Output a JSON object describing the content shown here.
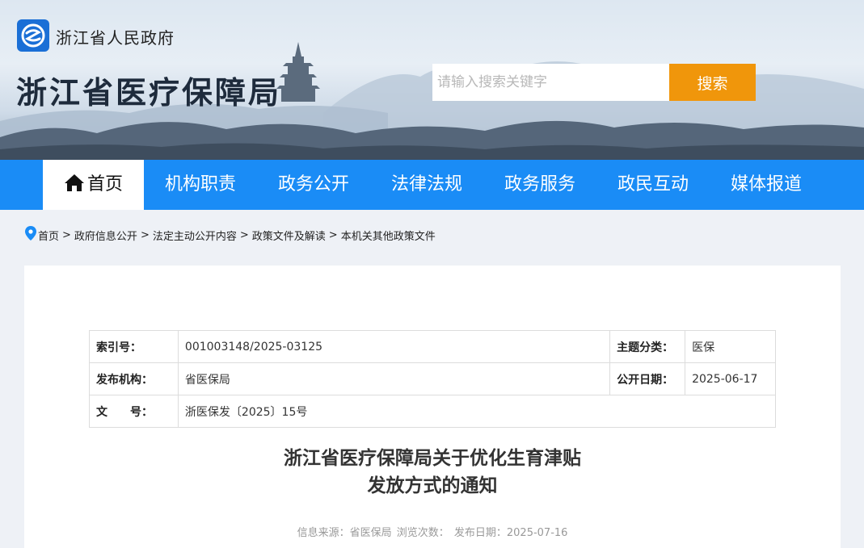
{
  "header": {
    "gov_name": "浙江省人民政府",
    "site_title": "浙江省医疗保障局",
    "search_placeholder": "请输入搜索关键字",
    "search_button": "搜索",
    "logo_icon": "zhejiang-gov-logo-icon"
  },
  "nav": {
    "items": [
      {
        "label": "首页",
        "active": true
      },
      {
        "label": "机构职责"
      },
      {
        "label": "政务公开"
      },
      {
        "label": "法律法规"
      },
      {
        "label": "政务服务"
      },
      {
        "label": "政民互动"
      },
      {
        "label": "媒体报道"
      }
    ]
  },
  "breadcrumb": {
    "icon": "location-pin-icon",
    "items": [
      "首页",
      "政府信息公开",
      "法定主动公开内容",
      "政策文件及解读",
      "本机关其他政策文件"
    ],
    "separator": ">"
  },
  "meta": {
    "index_label": "索引号：",
    "index_value": "001003148/2025-03125",
    "topic_label": "主题分类：",
    "topic_value": "医保",
    "issuer_label": "发布机构：",
    "issuer_value": "省医保局",
    "pub_date_label": "公开日期：",
    "pub_date_value": "2025-06-17",
    "docno_label": "文　　号：",
    "docno_value": "浙医保发〔2025〕15号"
  },
  "document": {
    "title_line1": "浙江省医疗保障局关于优化生育津贴",
    "title_line2": "发放方式的通知",
    "source": "信息来源：省医保局",
    "views": "浏览次数：",
    "date": "发布日期：2025-07-16"
  },
  "colors": {
    "nav_bg": "#1a8cf6",
    "search_button": "#f0960b",
    "page_bg": "#eef1f6"
  }
}
